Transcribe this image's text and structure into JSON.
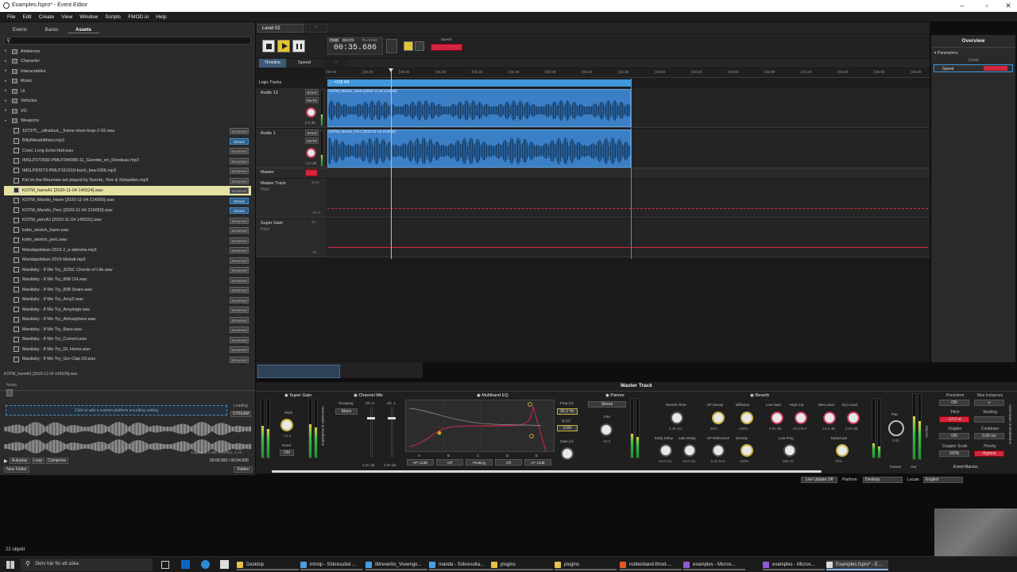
{
  "window": {
    "title": "Examples.fspro* - Event Editor"
  },
  "menu": [
    "File",
    "Edit",
    "Create",
    "View",
    "Window",
    "Scripts",
    "FMOD.io",
    "Help"
  ],
  "browser": {
    "tabs": [
      "Events",
      "Banks",
      "Assets"
    ],
    "folders": [
      "Ambience",
      "Character",
      "Interactables",
      "Music",
      "UI",
      "Vehicles",
      "VO",
      "Weapons"
    ],
    "files": [
      {
        "name": "167375__ultradust__frame-drum-loop-2-92.wav",
        "mode": "Streamed",
        "st": false,
        "sel": false
      },
      {
        "name": "BillyMandoMono.mp3",
        "mode": "Stream",
        "st": true,
        "sel": false
      },
      {
        "name": "Conic Long Echo Hall.wav",
        "mode": "Streamed",
        "st": false,
        "sel": false
      },
      {
        "name": "IMSLP270583-PMLP244089-11_Gavotte_en_Rondeau.mp3",
        "mode": "Streamed",
        "st": false,
        "sel": false
      },
      {
        "name": "IMSLP83273-PMLP151919-bach_bwv1006.mp3",
        "mode": "Streamed",
        "st": false,
        "sel": false
      },
      {
        "name": "Kid on the Mountain set played by Svente, Tore & Sébastien.mp3",
        "mode": "Streamed",
        "st": false,
        "sel": false
      },
      {
        "name": "KOTM_harmA1 [2020-11-04 145524].wav",
        "mode": "Streamed",
        "st": false,
        "sel": true
      },
      {
        "name": "KOTM_Mando_Harm [2020-11-04 214050].wav",
        "mode": "Stream",
        "st": true,
        "sel": false
      },
      {
        "name": "KOTM_Mando_Perc [2020-11-04 214050].wav",
        "mode": "Stream",
        "st": true,
        "sel": false
      },
      {
        "name": "KOTM_percA1 [2020-11-04 145531].wav",
        "mode": "Streamed",
        "st": false,
        "sel": false
      },
      {
        "name": "kotm_stretch_harm.wav",
        "mode": "Streamed",
        "st": false,
        "sel": false
      },
      {
        "name": "kotm_stretch_perc.wav",
        "mode": "Streamed",
        "st": false,
        "sel": false
      },
      {
        "name": "Mandapolskan 2019 2_a stämma.mp3",
        "mode": "Streamed",
        "st": false,
        "sel": false
      },
      {
        "name": "Mandapolskan 2019 Melodi.mp3",
        "mode": "Streamed",
        "st": false,
        "sel": false
      },
      {
        "name": "Manitsky - If We Try_3OSC Chords of Life.wav",
        "mode": "Streamed",
        "st": false,
        "sel": false
      },
      {
        "name": "Manitsky - If We Try_808 CH.wav",
        "mode": "Streamed",
        "st": false,
        "sel": false
      },
      {
        "name": "Manitsky - If We Try_808 Snare.wav",
        "mode": "Streamed",
        "st": false,
        "sel": false
      },
      {
        "name": "Manitsky - If We Try_Amy2.wav",
        "mode": "Streamed",
        "st": false,
        "sel": false
      },
      {
        "name": "Manitsky - If We Try_Amyleigh.wav",
        "mode": "Streamed",
        "st": false,
        "sel": false
      },
      {
        "name": "Manitsky - If We Try_Atmosphere.wav",
        "mode": "Streamed",
        "st": false,
        "sel": false
      },
      {
        "name": "Manitsky - If We Try_Bass.wav",
        "mode": "Streamed",
        "st": false,
        "sel": false
      },
      {
        "name": "Manitsky - If We Try_Current.wav",
        "mode": "Streamed",
        "st": false,
        "sel": false
      },
      {
        "name": "Manitsky - If We Try_DL Home.wav",
        "mode": "Streamed",
        "st": false,
        "sel": false
      },
      {
        "name": "Manitsky - If We Try_Grv Clap 03.wav",
        "mode": "Streamed",
        "st": false,
        "sel": false
      }
    ],
    "selected_path": "KOTM_harmA1 [2020-11-04 145524].wav",
    "notes_label": "Notes",
    "encoding_prompt": "Click to add a custom platform encoding setting",
    "loading_label": "Loading",
    "loading_value": "STREAM",
    "file_info": "Original: 1.4 MB, 44.1 kHz, 2 Ch",
    "time_range": "00:00.000 / 00:04.000",
    "autoplay": "Autoplay",
    "loop": "Loop",
    "compress": "Compress",
    "new_folder": "New Folder",
    "flatten": "Flatten"
  },
  "editor": {
    "tab": "Level 02",
    "time_label": "TIME",
    "beats_label": "BEATS",
    "playing_label": "PLAYING",
    "time_value": "00:35.686",
    "speed_label": "Speed",
    "sub_tabs": [
      "Timeline",
      "Speed"
    ],
    "ruler": [
      "00:00",
      "00:20",
      "00:40",
      "01:00",
      "01:20",
      "01:40",
      "02:00",
      "02:20",
      "02:40",
      "03:00",
      "03:20",
      "03:40",
      "04:00",
      "04:20",
      "04:40",
      "05:00",
      "05:20"
    ],
    "logic_tracks": "Logic Tracks",
    "tempo_marker": "♩=128 4/4",
    "tracks": [
      {
        "name": "Audio 13",
        "clip": "KOTM_Mando_Harm [2020-11-04 214050]",
        "vol": "0.0 dB"
      },
      {
        "name": "Audio 1",
        "clip": "KOTM_Mando_Perc [2020-11-04 214050]",
        "vol": "-2.0 dB"
      }
    ],
    "solo": "SOLO",
    "mute": "MUTE",
    "master": "Master",
    "automation": [
      {
        "name": "Master Track",
        "param": "Pitch",
        "top": "24 st",
        "bottom": "-24 st"
      },
      {
        "name": "Super Gain",
        "param": "Pitch",
        "top": "24",
        "bottom": "-24"
      }
    ]
  },
  "overview": {
    "title": "Overview",
    "parameters": "Parameters",
    "local": "Local",
    "param": "Speed"
  },
  "deck": {
    "title": "Master Track",
    "super_gain": {
      "title": "Super Gain",
      "pitch": "Pitch",
      "pitch_val": "-12.0",
      "invert": "Invert",
      "on": "ON",
      "side": "Automation & Modulation"
    },
    "channel_mix": {
      "title": "Channel Mix",
      "grouping": "Grouping",
      "mono": "Mono",
      "ch0": "Ch. 0",
      "ch1": "Ch. 1",
      "v0": "0.00 dB",
      "v1": "0.00 dB"
    },
    "eq": {
      "title": "Multiband EQ",
      "freq": "Freq (A)",
      "freq_val": "60.2 Hz",
      "q": "Q (A)",
      "q_val": "0.84",
      "gain": "Gain (A)",
      "bands": [
        "A",
        "B",
        "C",
        "D",
        "E"
      ],
      "modes": [
        "HP 12dB",
        "Off",
        "Peaking",
        "Off",
        "LP 12dB"
      ]
    },
    "panner": {
      "title": "Panner",
      "mode": "Stereo",
      "pan": "Pan",
      "pan_val": "-10.0"
    },
    "reverb": {
      "title": "Reverb",
      "row1": [
        {
          "l": "Reverb Time",
          "v": "4.45 sec"
        },
        {
          "l": "HF Decay",
          "v": "50%"
        },
        {
          "l": "Diffusion",
          "v": "100%"
        },
        {
          "l": "Low Gain",
          "v": "0.00 dB"
        },
        {
          "l": "High Cut",
          "v": "20.0 kHz"
        },
        {
          "l": "Wet Level",
          "v": "-10.5 dB"
        },
        {
          "l": "Dry Level",
          "v": "0.00 dB"
        }
      ],
      "row2": [
        {
          "l": "Early Delay",
          "v": "20.0 ms"
        },
        {
          "l": "Late Delay",
          "v": "40.0 ms"
        },
        {
          "l": "HF Reference",
          "v": "5.00 kHz"
        },
        {
          "l": "Density",
          "v": "100%"
        },
        {
          "l": "Low Freq",
          "v": "250 Hz"
        },
        {
          "l": "Early/Late",
          "v": "70%"
        }
      ]
    },
    "out": {
      "pan": "Pan",
      "pan_val": "0.00",
      "panner": "Panner",
      "out": "Out",
      "macros": "Macros"
    },
    "macros": {
      "persistent": "Persistent",
      "persistent_val": "ON",
      "max_instances": "Max Instances",
      "max_val": "∞",
      "pitch": "Pitch",
      "pitch_val": "-12.0 st",
      "stealing": "Stealing",
      "doppler": "Doppler",
      "doppler_val": "ON",
      "cooldown": "Cooldown",
      "cooldown_val": "0.00 ms",
      "doppler_scale": "Doppler Scale",
      "doppler_scale_val": "100%",
      "priority": "Priority",
      "priority_val": "Highest",
      "event_macros": "Event Macros",
      "side": "Automation & Modulation"
    }
  },
  "statusbar": {
    "live_update": "Live Update Off",
    "platform_label": "Platform",
    "platform": "Desktop",
    "locale_label": "Locale",
    "locale": "English",
    "objects": "22 objekt"
  },
  "taskbar": {
    "search": "Skriv här för att söka",
    "items": [
      "Desktop",
      "irmslp - Sökresultat ...",
      "IMreverbs_Voxengo...",
      "manda - Sökresulta...",
      "plugins",
      "plugins",
      "rubberband-fmod-...",
      "examples - Micros...",
      "examples - Micros...",
      "Examples.fspro* - E..."
    ]
  },
  "colors": {
    "accent": "#3f97dc",
    "clip": "#3b7fc7",
    "red": "#d3263f",
    "yellow": "#e6e2a4"
  }
}
